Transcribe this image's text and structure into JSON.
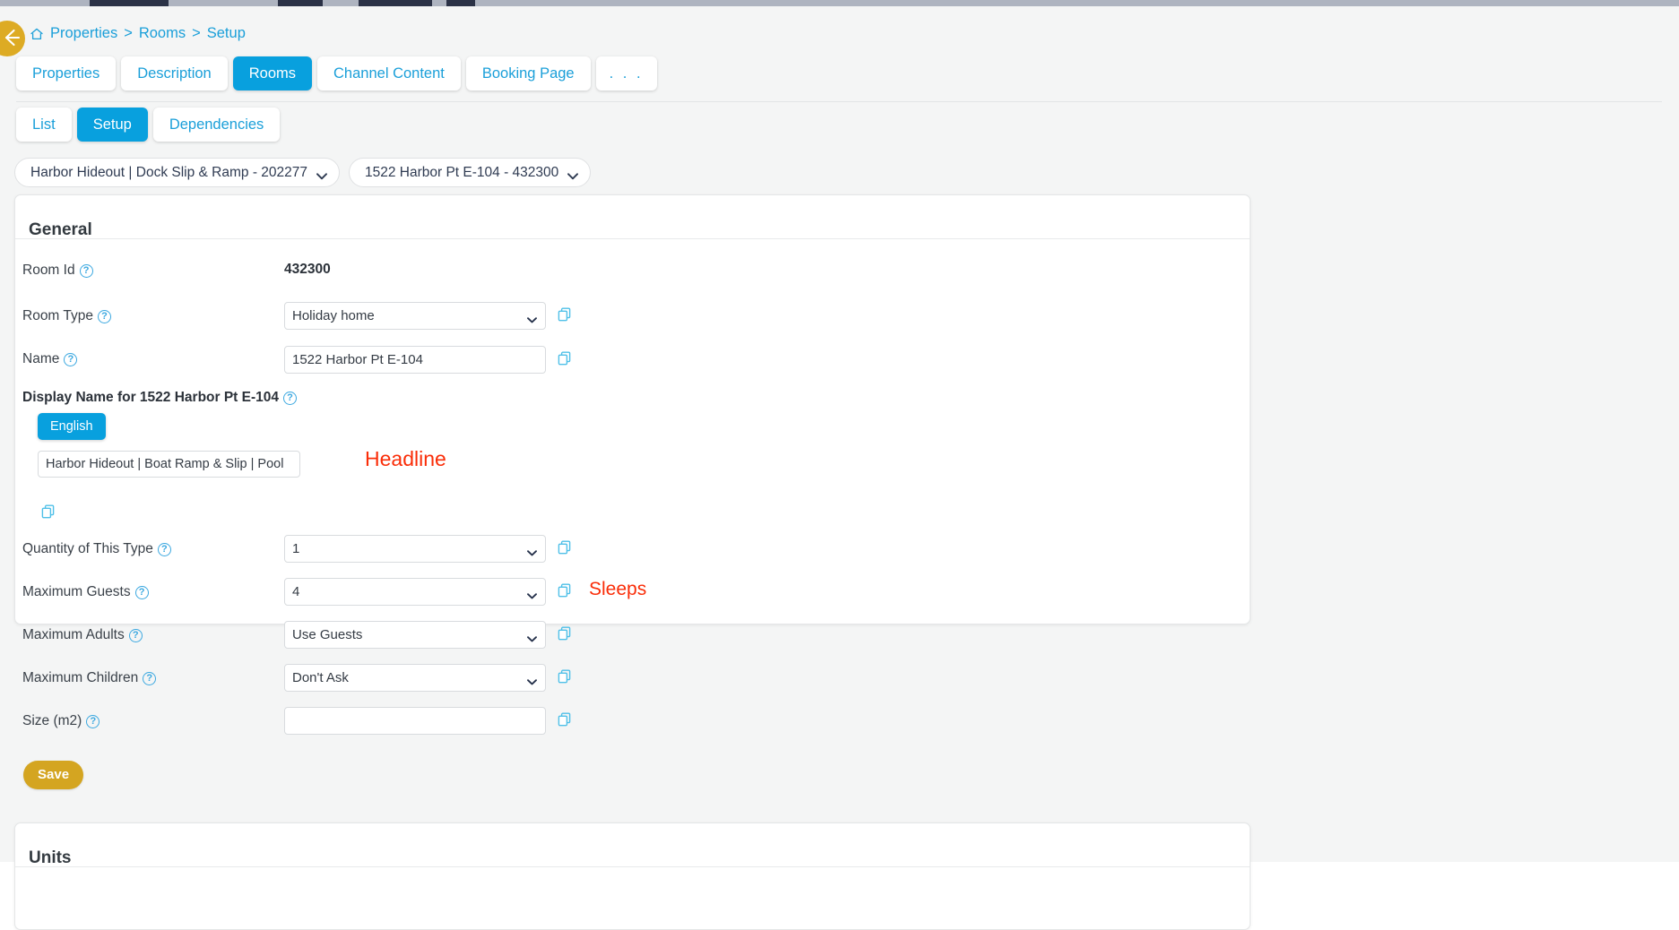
{
  "colors": {
    "accent_blue": "#08a0de",
    "link_blue": "#1a9fd9",
    "gold": "#d4a521",
    "back_gold": "#ddab24",
    "annotation_red": "#fa2d08",
    "copy_icon_blue": "#4fc0e8",
    "page_bg": "#f4f5f5"
  },
  "back_button": {
    "icon": "arrow-left-icon"
  },
  "breadcrumb": {
    "home_icon": "home-icon",
    "items": [
      "Properties",
      "Rooms",
      "Setup"
    ],
    "separator": ">"
  },
  "tabs": [
    {
      "label": "Properties",
      "active": false
    },
    {
      "label": "Description",
      "active": false
    },
    {
      "label": "Rooms",
      "active": true
    },
    {
      "label": "Channel Content",
      "active": false
    },
    {
      "label": "Booking Page",
      "active": false
    },
    {
      "label": ". . .",
      "active": false
    }
  ],
  "subtabs": [
    {
      "label": "List",
      "active": false
    },
    {
      "label": "Setup",
      "active": true
    },
    {
      "label": "Dependencies",
      "active": false
    }
  ],
  "selectors": {
    "property": "Harbor Hideout | Dock Slip & Ramp - 202277",
    "room": "1522 Harbor Pt E-104 - 432300"
  },
  "general": {
    "title": "General",
    "help_icon": "question-circle-icon",
    "copy_icon": "copy-icon",
    "chevron_icon": "chevron-down-icon",
    "rows": {
      "room_id": {
        "label": "Room Id",
        "value": "432300"
      },
      "room_type": {
        "label": "Room Type",
        "value": "Holiday home"
      },
      "name": {
        "label": "Name",
        "value": "1522 Harbor Pt E-104"
      },
      "display_name": {
        "label": "Display Name for 1522 Harbor Pt E-104",
        "language_button": "English",
        "value": "Harbor Hideout | Boat Ramp & Slip | Pool",
        "annotation": "Headline"
      },
      "quantity": {
        "label": "Quantity of This Type",
        "value": "1"
      },
      "max_guests": {
        "label": "Maximum Guests",
        "value": "4",
        "annotation": "Sleeps"
      },
      "max_adults": {
        "label": "Maximum Adults",
        "value": "Use Guests"
      },
      "max_children": {
        "label": "Maximum Children",
        "value": "Don't Ask"
      },
      "size": {
        "label": "Size (m2)",
        "value": "",
        "placeholder": ""
      }
    },
    "save_label": "Save"
  },
  "units": {
    "title": "Units"
  }
}
